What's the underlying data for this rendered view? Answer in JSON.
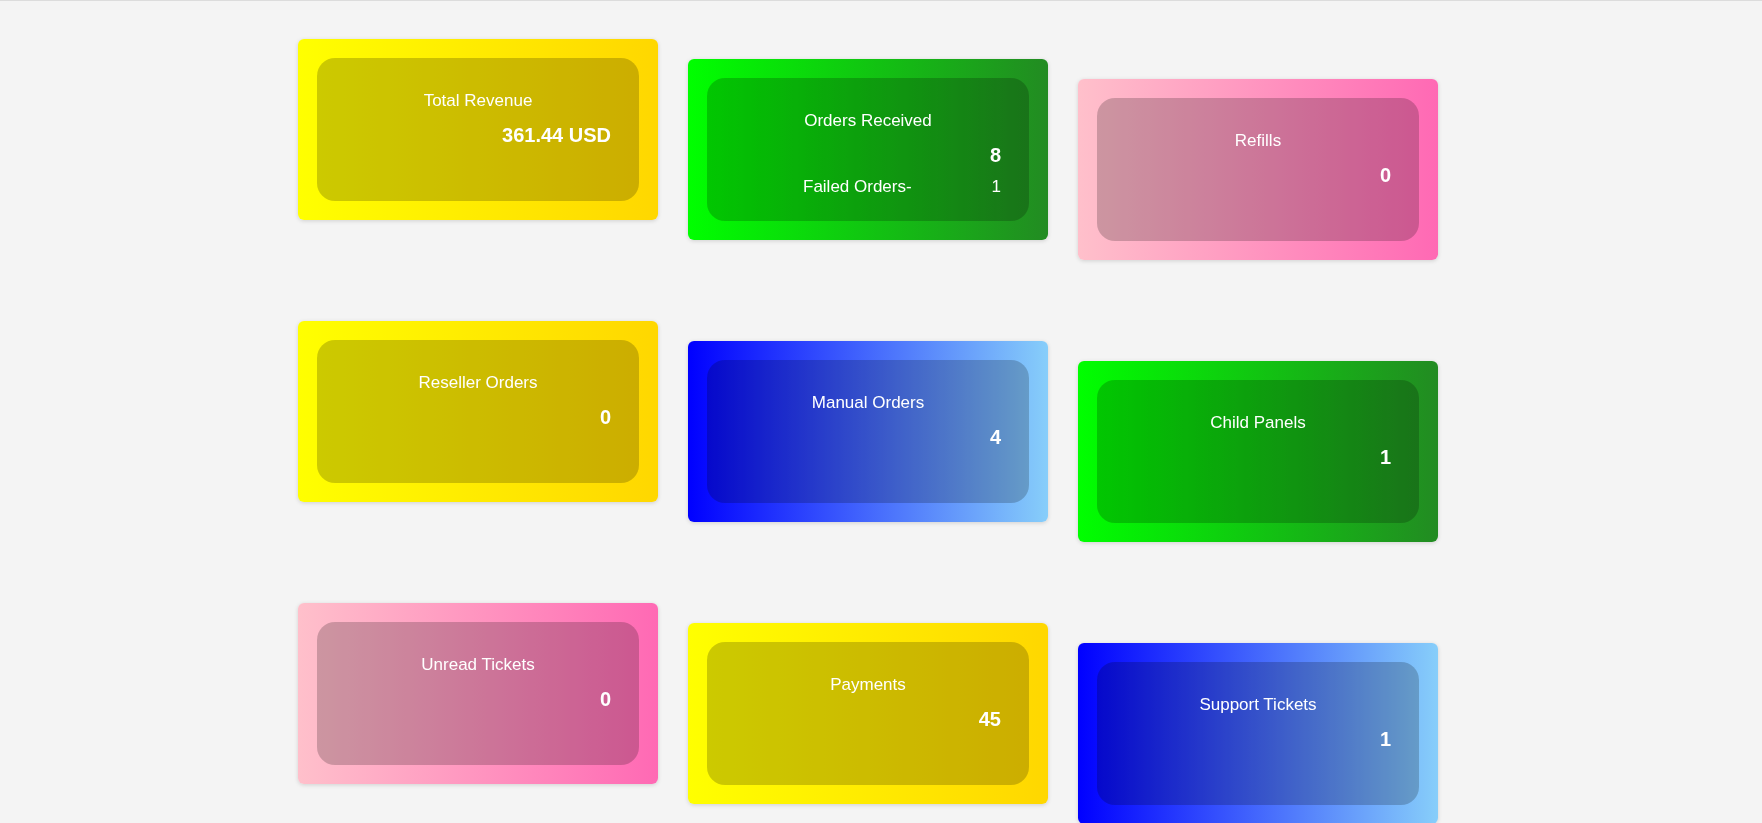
{
  "cards": [
    {
      "title": "Total Revenue",
      "value": "361.44 USD",
      "color": "#ffff00"
    },
    {
      "title": "Orders Received",
      "value": "8",
      "color": "#00ff00",
      "sub": {
        "label": "Failed Orders-",
        "value": "1"
      }
    },
    {
      "title": "Refills",
      "value": "0",
      "color": "#ffc0cb"
    },
    {
      "title": "Reseller Orders",
      "value": "0",
      "color": "#ffff00"
    },
    {
      "title": "Manual Orders",
      "value": "4",
      "color": "#0000ff"
    },
    {
      "title": "Child Panels",
      "value": "1",
      "color": "#00ff00"
    },
    {
      "title": "Unread Tickets",
      "value": "0",
      "color": "#ffc0cb"
    },
    {
      "title": "Payments",
      "value": "45",
      "color": "#ffff00"
    },
    {
      "title": "Support Tickets",
      "value": "1",
      "color": "#0000ff"
    }
  ]
}
